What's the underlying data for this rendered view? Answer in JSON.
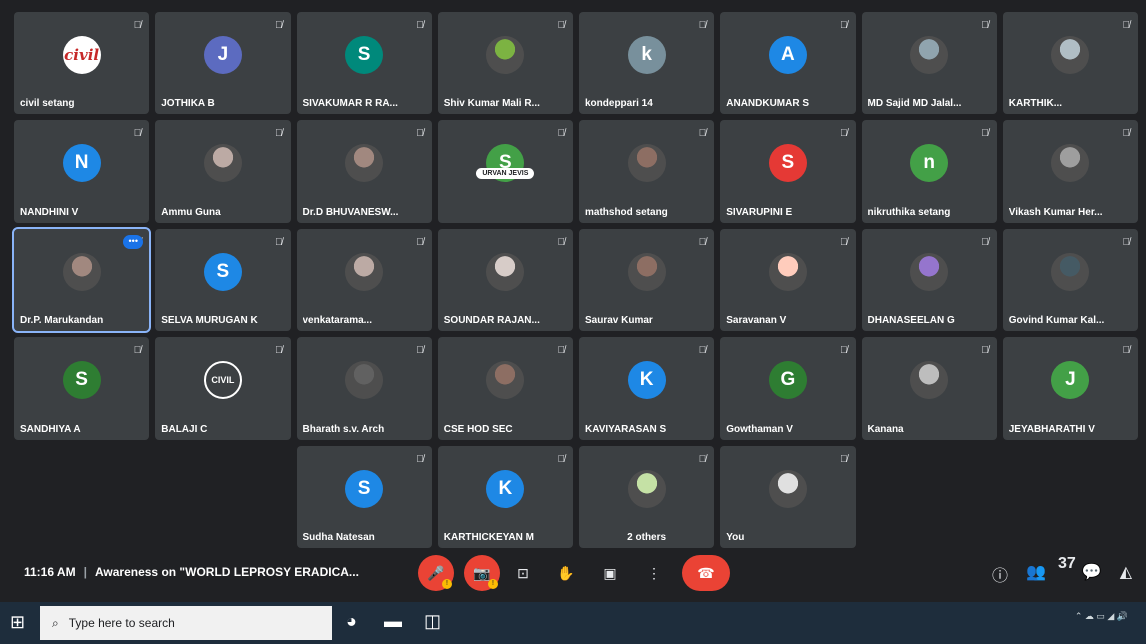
{
  "meeting": {
    "time": "11:16 AM",
    "title": "Awareness on \"WORLD LEPROSY ERADICA..."
  },
  "colors": {
    "background": "#202124",
    "tile": "#3c4043",
    "mic_off": "#ea4335",
    "active_border": "#8ab4f8"
  },
  "tiles": [
    {
      "name": "civil setang",
      "initial": "civil",
      "avatar_type": "logo",
      "color": "#ffffff"
    },
    {
      "name": "JOTHIKA B",
      "initial": "J",
      "avatar_type": "letter",
      "color": "#5c6bc0"
    },
    {
      "name": "SIVAKUMAR R RA...",
      "initial": "S",
      "avatar_type": "letter",
      "color": "#00897b"
    },
    {
      "name": "Shiv Kumar Mali R...",
      "initial": "",
      "avatar_type": "photo",
      "color": "#7cb342"
    },
    {
      "name": "kondeppari 14",
      "initial": "k",
      "avatar_type": "letter",
      "color": "#78909c"
    },
    {
      "name": "ANANDKUMAR S",
      "initial": "A",
      "avatar_type": "letter",
      "color": "#1e88e5"
    },
    {
      "name": "MD Sajid MD Jalal...",
      "initial": "",
      "avatar_type": "photo",
      "color": "#90a4ae"
    },
    {
      "name": "KARTHIK...",
      "initial": "",
      "avatar_type": "photo",
      "color": "#b0bec5"
    },
    {
      "name": "NANDHINI V",
      "initial": "N",
      "avatar_type": "letter",
      "color": "#1e88e5"
    },
    {
      "name": "Ammu Guna",
      "initial": "",
      "avatar_type": "photo",
      "color": "#bcaaa4"
    },
    {
      "name": "Dr.D BHUVANESW...",
      "initial": "",
      "avatar_type": "photo",
      "color": "#a1887f"
    },
    {
      "name": "",
      "initial": "S",
      "avatar_type": "letter",
      "color": "#43a047",
      "chip": "URVAN JEVIS"
    },
    {
      "name": "mathshod setang",
      "initial": "",
      "avatar_type": "photo",
      "color": "#8d6e63"
    },
    {
      "name": "SIVARUPINI E",
      "initial": "S",
      "avatar_type": "letter",
      "color": "#e53935"
    },
    {
      "name": "nikruthika setang",
      "initial": "n",
      "avatar_type": "letter",
      "color": "#43a047"
    },
    {
      "name": "Vikash Kumar Her...",
      "initial": "",
      "avatar_type": "photo",
      "color": "#9e9e9e"
    },
    {
      "name": "Dr.P. Marukandan",
      "initial": "",
      "avatar_type": "photo",
      "color": "#a1887f",
      "active": true
    },
    {
      "name": "SELVA MURUGAN K",
      "initial": "S",
      "avatar_type": "letter",
      "color": "#1e88e5"
    },
    {
      "name": "venkatarama...",
      "initial": "",
      "avatar_type": "photo",
      "color": "#bcaaa4"
    },
    {
      "name": "SOUNDAR RAJAN...",
      "initial": "",
      "avatar_type": "photo",
      "color": "#d7ccc8"
    },
    {
      "name": "Saurav Kumar",
      "initial": "",
      "avatar_type": "photo",
      "color": "#8d6e63"
    },
    {
      "name": "Saravanan V",
      "initial": "",
      "avatar_type": "photo",
      "color": "#ffccbc"
    },
    {
      "name": "DHANASEELAN G",
      "initial": "",
      "avatar_type": "photo",
      "color": "#9575cd"
    },
    {
      "name": "Govind Kumar Kal...",
      "initial": "",
      "avatar_type": "photo",
      "color": "#455a64"
    },
    {
      "name": "SANDHIYA A",
      "initial": "S",
      "avatar_type": "letter",
      "color": "#2e7d32"
    },
    {
      "name": "BALAJI C",
      "initial": "CIVIL",
      "avatar_type": "circle-logo",
      "color": "#000000"
    },
    {
      "name": "Bharath s.v. Arch",
      "initial": "",
      "avatar_type": "photo",
      "color": "#616161"
    },
    {
      "name": "CSE HOD SEC",
      "initial": "",
      "avatar_type": "photo",
      "color": "#8d6e63"
    },
    {
      "name": "KAVIYARASAN S",
      "initial": "K",
      "avatar_type": "letter",
      "color": "#1e88e5"
    },
    {
      "name": "Gowthaman V",
      "initial": "G",
      "avatar_type": "letter",
      "color": "#2e7d32"
    },
    {
      "name": "Kanana",
      "initial": "",
      "avatar_type": "photo",
      "color": "#bdbdbd"
    },
    {
      "name": "JEYABHARATHI V",
      "initial": "J",
      "avatar_type": "letter",
      "color": "#43a047"
    },
    {
      "name": "",
      "initial": "",
      "avatar_type": "empty",
      "color": ""
    },
    {
      "name": "",
      "initial": "",
      "avatar_type": "empty",
      "color": ""
    },
    {
      "name": "Sudha Natesan",
      "initial": "S",
      "avatar_type": "letter",
      "color": "#1e88e5"
    },
    {
      "name": "KARTHICKEYAN M",
      "initial": "K",
      "avatar_type": "letter",
      "color": "#1e88e5"
    },
    {
      "name": "2 others",
      "initial": "",
      "avatar_type": "photo",
      "color": "#c5e1a5",
      "center": true
    },
    {
      "name": "You",
      "initial": "",
      "avatar_type": "photo",
      "color": "#e0e0e0"
    },
    {
      "name": "",
      "initial": "",
      "avatar_type": "empty",
      "color": ""
    },
    {
      "name": "",
      "initial": "",
      "avatar_type": "empty",
      "color": ""
    }
  ],
  "controls": {
    "participants_count": "37"
  },
  "taskbar": {
    "search_placeholder": "Type here to search"
  }
}
